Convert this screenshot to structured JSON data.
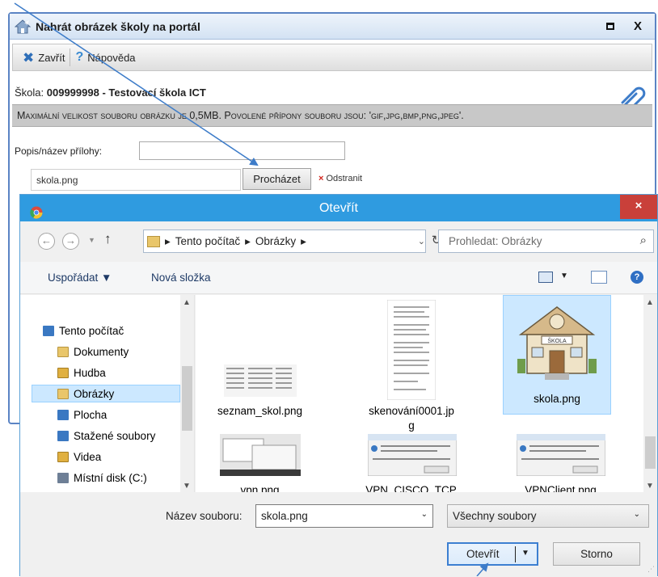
{
  "portal": {
    "title": "Nahrát obrázek školy na portál",
    "toolbar": {
      "close_label": "Zavřít",
      "help_label": "Nápověda"
    },
    "school_label": "Škola:",
    "school_value": "009999998 - Testovací škola ICT",
    "notice": "Maximální velikost souboru obrázku je 0,5MB. Povolené přípony souboru jsou: 'gif,jpg,bmp,png,jpeg'.",
    "popis_label": "Popis/název přílohy:",
    "popis_value": "",
    "file_value": "skola.png",
    "browse_label": "Procházet",
    "remove_label": "Odstranit"
  },
  "dialog": {
    "title": "Otevřít",
    "close_glyph": "×",
    "path": [
      "Tento počítač",
      "Obrázky"
    ],
    "search_placeholder": "Prohledat: Obrázky",
    "organize_label": "Uspořádat ▼",
    "new_folder_label": "Nová složka",
    "nav_items": [
      {
        "label": "Tento počítač",
        "icon": "computer-icon",
        "color": "#3a78c2"
      },
      {
        "label": "Dokumenty",
        "icon": "documents-icon",
        "color": "#e9c66a"
      },
      {
        "label": "Hudba",
        "icon": "music-icon",
        "color": "#e0b040"
      },
      {
        "label": "Obrázky",
        "icon": "pictures-icon",
        "color": "#e9c66a"
      },
      {
        "label": "Plocha",
        "icon": "desktop-icon",
        "color": "#3a78c2"
      },
      {
        "label": "Stažené soubory",
        "icon": "downloads-icon",
        "color": "#3a78c2"
      },
      {
        "label": "Videa",
        "icon": "videos-icon",
        "color": "#e0b040"
      },
      {
        "label": "Místní disk (C:)",
        "icon": "disk-icon",
        "color": "#6e7f96"
      }
    ],
    "files": [
      {
        "name": "seznam_skol.png"
      },
      {
        "name": "skenování0001.jpg"
      },
      {
        "name": "skola.png"
      },
      {
        "name": "vpn.png"
      },
      {
        "name": "VPN_CISCO_TCP."
      },
      {
        "name": "VPNClient.png"
      }
    ],
    "filename_label": "Název souboru:",
    "filename_value": "skola.png",
    "filetype_value": "Všechny soubory",
    "open_label": "Otevřít",
    "cancel_label": "Storno"
  },
  "colors": {
    "dialog_title": "#2f9be0",
    "close_red": "#c9403a",
    "selection": "#cce8ff",
    "arrow": "#3d7cc9"
  }
}
